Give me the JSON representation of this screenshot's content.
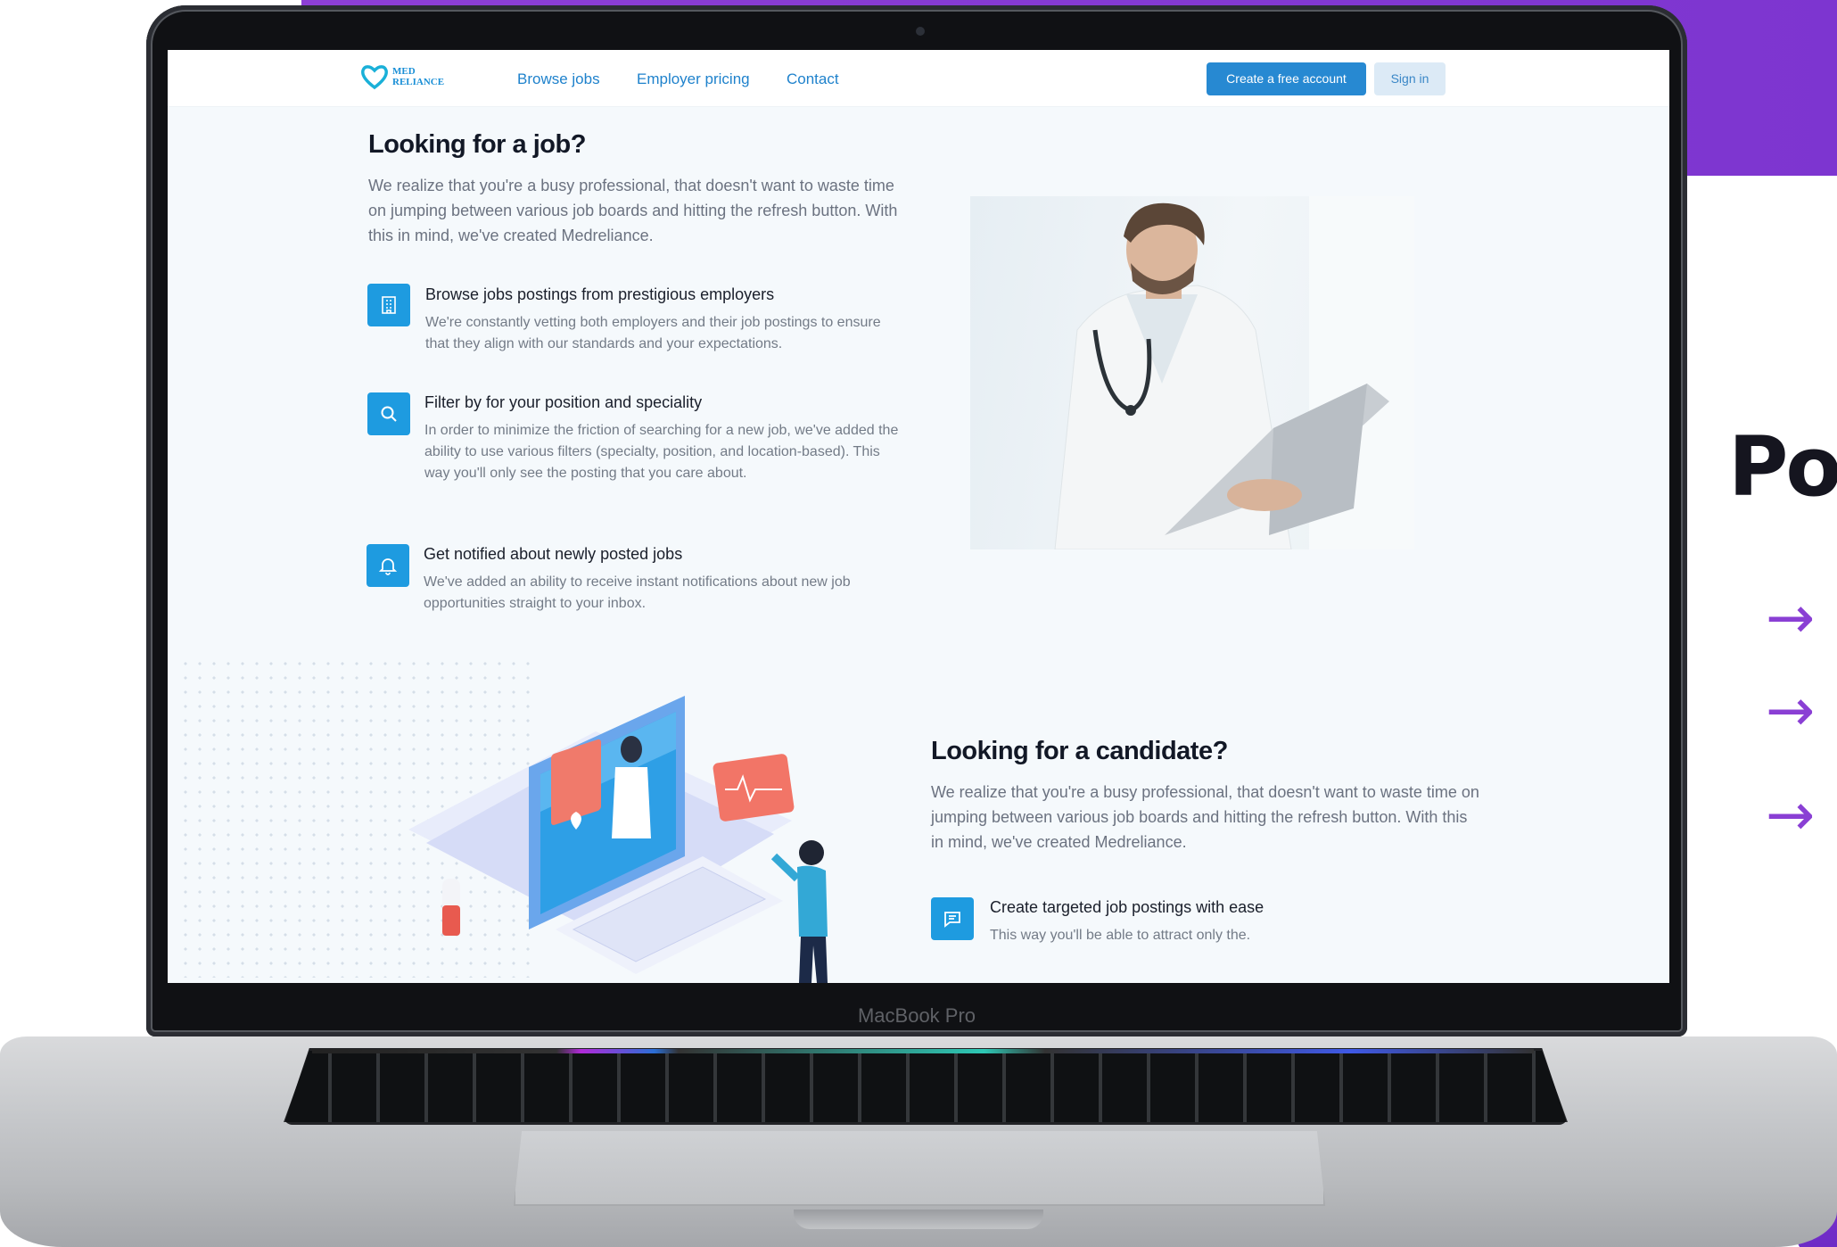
{
  "navbar": {
    "logo_line1": "MED",
    "logo_line2": "RELIANCE",
    "links": [
      "Browse jobs",
      "Employer pricing",
      "Contact"
    ],
    "create_account": "Create a free account",
    "sign_in": "Sign in"
  },
  "job_section": {
    "title": "Looking for a job?",
    "lead": "We realize that you're a busy professional, that doesn't want to waste time on jumping between various job boards and hitting the refresh button. With this in mind, we've created Medreliance.",
    "features": [
      {
        "icon": "building-icon",
        "title": "Browse jobs postings from prestigious employers",
        "desc": "We're constantly vetting both employers and their job postings to ensure that they align with our standards and your expectations."
      },
      {
        "icon": "search-icon",
        "title": "Filter by for your position and speciality",
        "desc": "In order to minimize the friction of searching for a new job, we've added the ability to use various filters (specialty, position, and location-based). This way you'll only see the posting that you care about."
      },
      {
        "icon": "bell-icon",
        "title": "Get notified about newly posted jobs",
        "desc": "We've added an ability to receive instant notifications about new job opportunities straight to your inbox."
      }
    ]
  },
  "candidate_section": {
    "title": "Looking for a candidate?",
    "lead": "We realize that you're a busy professional, that doesn't want to waste time on jumping between various job boards and hitting the refresh button. With this in mind, we've created Medreliance.",
    "features": [
      {
        "icon": "chat-icon",
        "title": "Create targeted job postings with ease",
        "desc": "This way you'll be able to attract only the."
      }
    ]
  },
  "device": {
    "brand_label": "MacBook Pro"
  },
  "side_panel": {
    "heading_fragment": "Pol",
    "arrow_glyph": "→"
  },
  "colors": {
    "accent_blue": "#1e9be0",
    "purple": "#8a3fd4"
  }
}
